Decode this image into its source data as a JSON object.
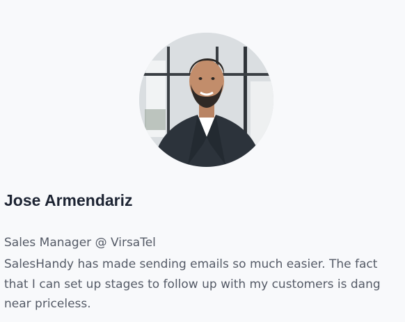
{
  "testimonial": {
    "name": "Jose Armendariz",
    "role": "Sales Manager @ VirsaTel",
    "quote": "SalesHandy has made sending emails so much easier. The fact that I can set up stages to follow up with my customers is dang near priceless."
  },
  "colors": {
    "background": "#f8f9fb",
    "name_text": "#1d2433",
    "body_text": "#545a66"
  }
}
